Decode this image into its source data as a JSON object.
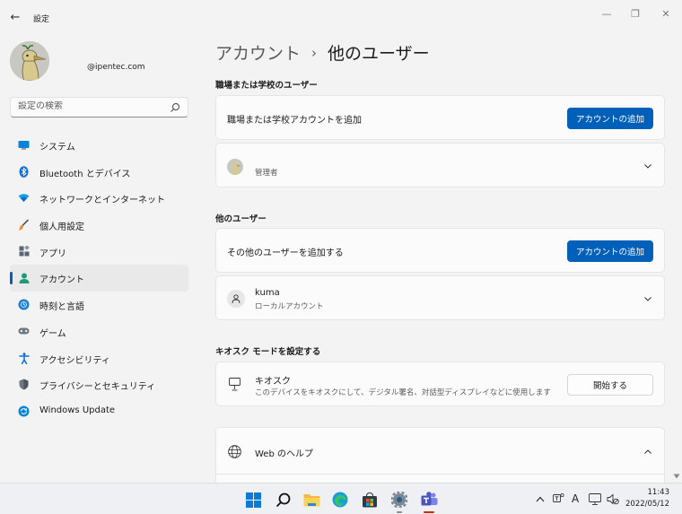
{
  "window": {
    "title": "設定",
    "back_glyph": "←",
    "minimize_glyph": "—",
    "maximize_glyph": "❐",
    "close_glyph": "✕"
  },
  "account": {
    "email": "@ipentec.com",
    "avatar_icon": "duck-avatar-icon"
  },
  "search": {
    "placeholder": "設定の検索",
    "icon": "search-icon"
  },
  "nav": {
    "items": [
      {
        "label": "システム",
        "icon": "system-icon",
        "active": false
      },
      {
        "label": "Bluetooth とデバイス",
        "icon": "bluetooth-icon",
        "active": false
      },
      {
        "label": "ネットワークとインターネット",
        "icon": "network-icon",
        "active": false
      },
      {
        "label": "個人用設定",
        "icon": "brush-icon",
        "active": false
      },
      {
        "label": "アプリ",
        "icon": "apps-icon",
        "active": false
      },
      {
        "label": "アカウント",
        "icon": "account-icon",
        "active": true
      },
      {
        "label": "時刻と言語",
        "icon": "time-language-icon",
        "active": false
      },
      {
        "label": "ゲーム",
        "icon": "gaming-icon",
        "active": false
      },
      {
        "label": "アクセシビリティ",
        "icon": "accessibility-icon",
        "active": false
      },
      {
        "label": "プライバシーとセキュリティ",
        "icon": "shield-icon",
        "active": false
      },
      {
        "label": "Windows Update",
        "icon": "update-icon",
        "active": false
      }
    ]
  },
  "breadcrumb": {
    "parent": "アカウント",
    "separator": "›",
    "current": "他のユーザー"
  },
  "work_section": {
    "title": "職場または学校のユーザー",
    "add_label": "職場または学校アカウントを追加",
    "add_button": "アカウントの追加",
    "user_role": "管理者"
  },
  "other_section": {
    "title": "他のユーザー",
    "add_label": "その他のユーザーを追加する",
    "add_button": "アカウントの追加",
    "user_name": "kuma",
    "user_type": "ローカルアカウント"
  },
  "kiosk_section": {
    "title": "キオスク モードを設定する",
    "label": "キオスク",
    "description": "このデバイスをキオスクにして、デジタル署名、対話型ディスプレイなどに使用します",
    "button": "開始する"
  },
  "help": {
    "label": "Web のヘルプ"
  },
  "taskbar": {
    "tray_ime": "A",
    "clock_time": "11:43",
    "clock_date": "2022/05/12"
  },
  "colors": {
    "accent": "#005fb8",
    "background": "#f3f3f3",
    "card": "#fbfbfb"
  }
}
